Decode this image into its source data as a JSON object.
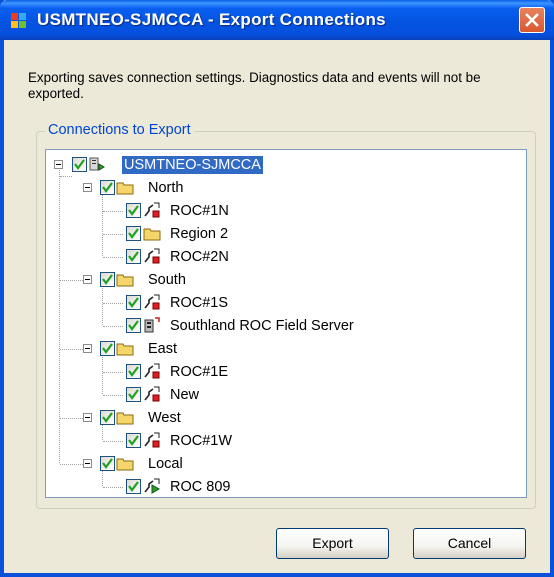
{
  "window": {
    "title": "USMTNEO-SJMCCA - Export Connections"
  },
  "description": "Exporting saves connection settings.  Diagnostics data and events will not be exported.",
  "group": {
    "label": "Connections to Export"
  },
  "tree": {
    "root": "USMTNEO-SJMCCA",
    "north": "North",
    "roc1n": "ROC#1N",
    "region2": "Region 2",
    "roc2n": "ROC#2N",
    "south": "South",
    "roc1s": "ROC#1S",
    "southland": "Southland ROC Field Server",
    "east": "East",
    "roc1e": "ROC#1E",
    "new": "New",
    "west": "West",
    "roc1w": "ROC#1W",
    "local": "Local",
    "roc809": "ROC 809"
  },
  "buttons": {
    "export": "Export",
    "cancel": "Cancel"
  },
  "colors": {
    "titlebar": "#0453e0",
    "selection": "#316ac5",
    "group_label": "#0046d5",
    "check": "#21a121"
  }
}
